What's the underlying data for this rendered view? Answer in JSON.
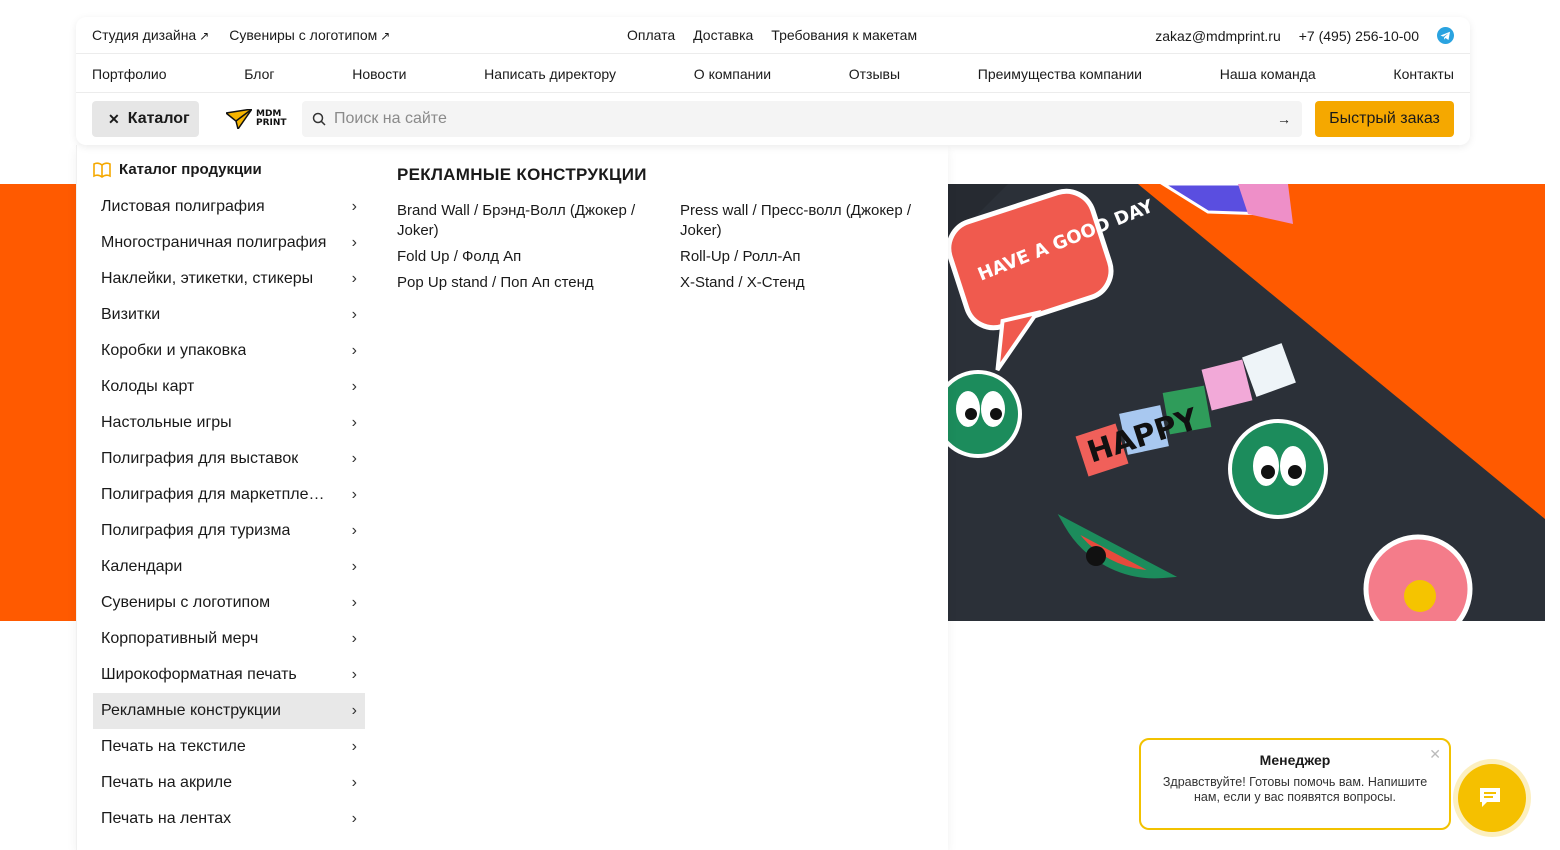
{
  "topbar": {
    "left_links": [
      "Студия дизайна",
      "Сувениры с логотипом"
    ],
    "center_links": [
      "Оплата",
      "Доставка",
      "Требования к макетам"
    ],
    "email": "zakaz@mdmprint.ru",
    "phone": "+7 (495) 256-10-00"
  },
  "nav": [
    "Портфолио",
    "Блог",
    "Новости",
    "Написать директору",
    "О компании",
    "Отзывы",
    "Преимущества компании",
    "Наша команда",
    "Контакты"
  ],
  "searchbar": {
    "catalog_label": "Каталог",
    "logo_line1": "MDM",
    "logo_line2": "PRINT",
    "placeholder": "Поиск на сайте",
    "quick_order_label": "Быстрый заказ"
  },
  "catalog": {
    "heading": "Каталог продукции",
    "items": [
      "Листовая полиграфия",
      "Многостраничная полиграфия",
      "Наклейки, этикетки, стикеры",
      "Визитки",
      "Коробки и упаковка",
      "Колоды карт",
      "Настольные игры",
      "Полиграфия для выставок",
      "Полиграфия для маркетплейсов",
      "Полиграфия для туризма",
      "Календари",
      "Сувениры с логотипом",
      "Корпоративный мерч",
      "Широкоформатная печать",
      "Рекламные конструкции",
      "Печать на текстиле",
      "Печать на акриле",
      "Печать на лентах"
    ],
    "active_index": 14
  },
  "submenu": {
    "title": "РЕКЛАМНЫЕ КОНСТРУКЦИИ",
    "items": [
      "Brand Wall / Брэнд-Волл (Джокер / Joker)",
      "Press wall / Пресс-волл (Джокер / Joker)",
      "Fold Up / Фолд Ап",
      "Roll-Up / Ролл-Ап",
      "Pop Up stand / Поп Ап стенд",
      "X-Stand / X-Стенд"
    ]
  },
  "chat": {
    "title": "Менеджер",
    "text": "Здравствуйте! Готовы помочь вам. Напишите нам, если у вас появятся вопросы."
  },
  "hero": {
    "sticker_texts": [
      "HAVE A GOOD DAY",
      "HAPPY"
    ]
  },
  "colors": {
    "accent_orange": "#ff5a00",
    "button_yellow": "#f5a800",
    "chat_yellow": "#f2c200",
    "telegram": "#2aa3e0"
  },
  "icons": [
    "arrow-up-right-icon",
    "telegram-icon",
    "close-icon",
    "search-icon",
    "arrow-right-icon",
    "book-icon",
    "chevron-right-icon",
    "chat-icon"
  ]
}
